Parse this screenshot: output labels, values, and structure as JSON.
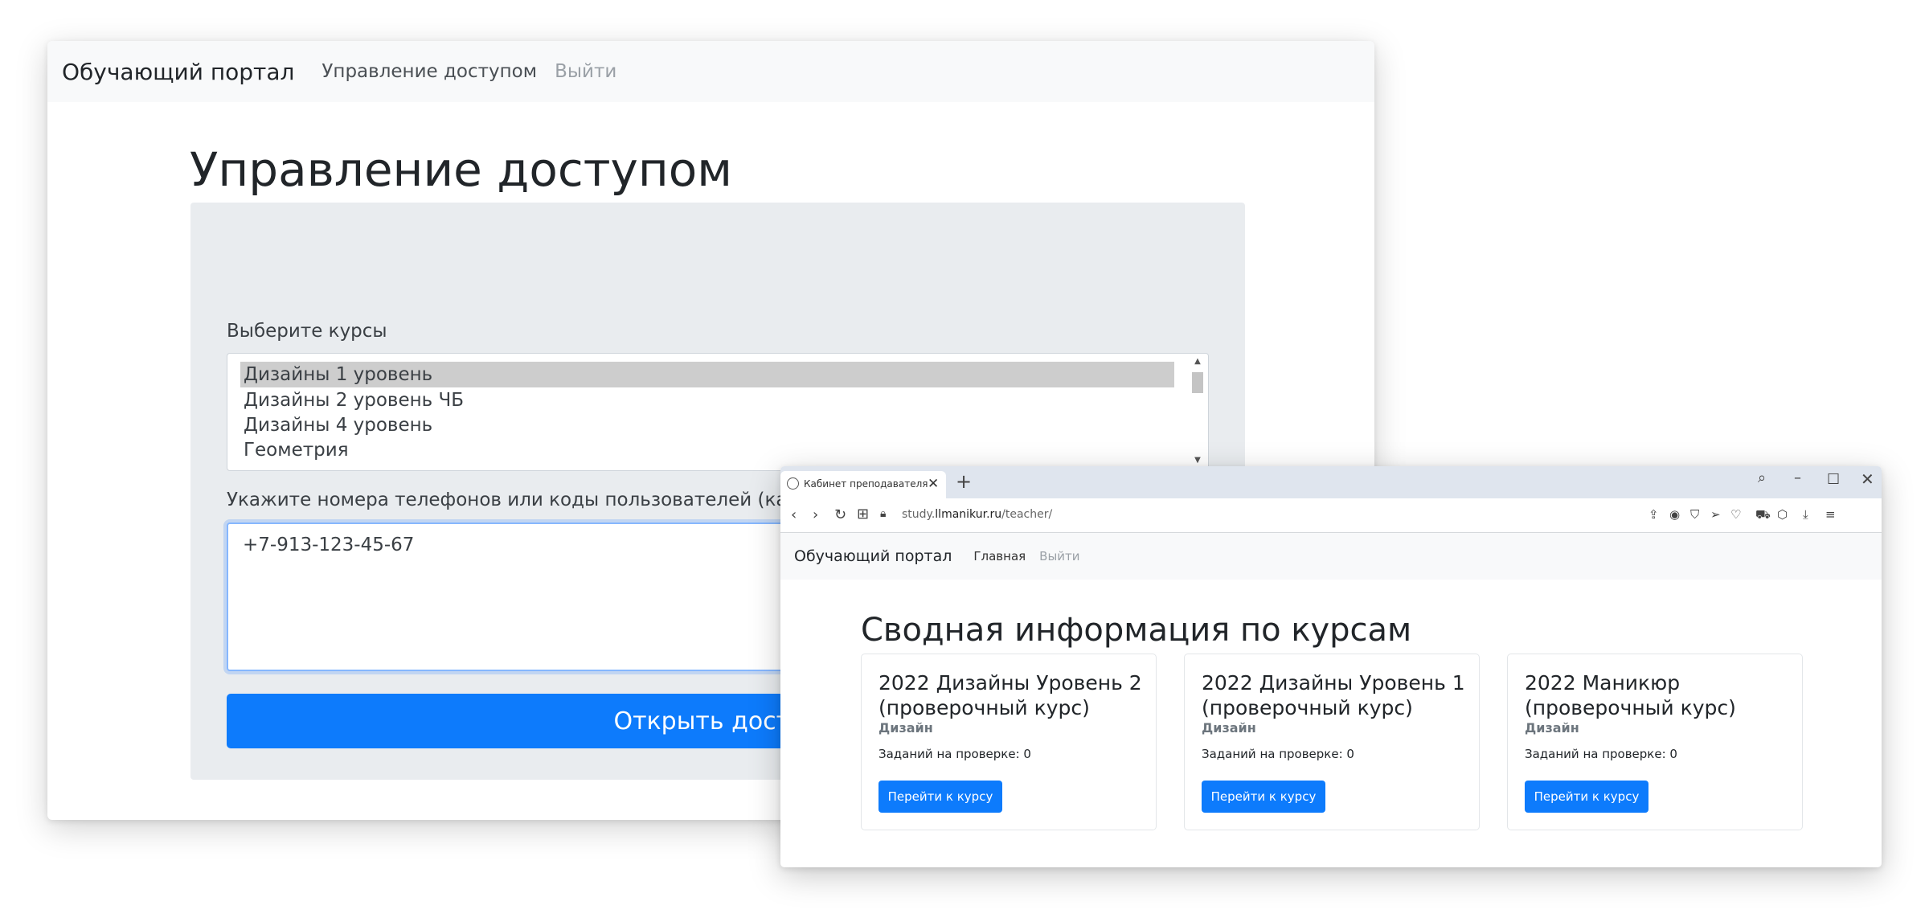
{
  "admin": {
    "brand": "Обучающий портал",
    "nav": {
      "access": "Управление доступом",
      "logout": "Выйти"
    },
    "title": "Управление доступом",
    "courses_label": "Выберите курсы",
    "courses": [
      "Дизайны 1 уровень",
      "Дизайны 2 уровень ЧБ",
      "Дизайны 4 уровень",
      "Геометрия"
    ],
    "selected_course": "Дизайны 1 уровень",
    "phones_label": "Укажите номера телефонов или коды пользователей (каждый на новой строке)",
    "phones_value": "+7-913-123-45-67",
    "submit_label": "Открыть доступ"
  },
  "browser": {
    "tab_title": "Кабинет преподавателя",
    "url_prefix": "study.",
    "url_domain": "llmanikur.ru",
    "url_path": "/teacher/",
    "icons": [
      "search-icon",
      "minimize-icon",
      "maximize-icon",
      "close-icon",
      "back-icon",
      "forward-icon",
      "reload-icon",
      "grid-icon",
      "lock-icon"
    ]
  },
  "teacher": {
    "brand": "Обучающий портал",
    "nav": {
      "home": "Главная",
      "logout": "Выйти"
    },
    "title": "Сводная информация по курсам",
    "cards": [
      {
        "title": "2022 Дизайны Уровень 2 (проверочный курс)",
        "category": "Дизайн",
        "pending": "Заданий на проверке: 0",
        "button": "Перейти к курсу"
      },
      {
        "title": "2022 Дизайны Уровень 1 (проверочный курс)",
        "category": "Дизайн",
        "pending": "Заданий на проверке: 0",
        "button": "Перейти к курсу"
      },
      {
        "title": "2022 Маникюр (проверочный курс)",
        "category": "Дизайн",
        "pending": "Заданий на проверке: 0",
        "button": "Перейти к курсу"
      }
    ]
  },
  "colors": {
    "primary": "#0d7bfc",
    "navbar_bg": "#f8f9fa",
    "card_bg": "#e9ecef",
    "titlebar_bg": "#dfe5ee"
  }
}
